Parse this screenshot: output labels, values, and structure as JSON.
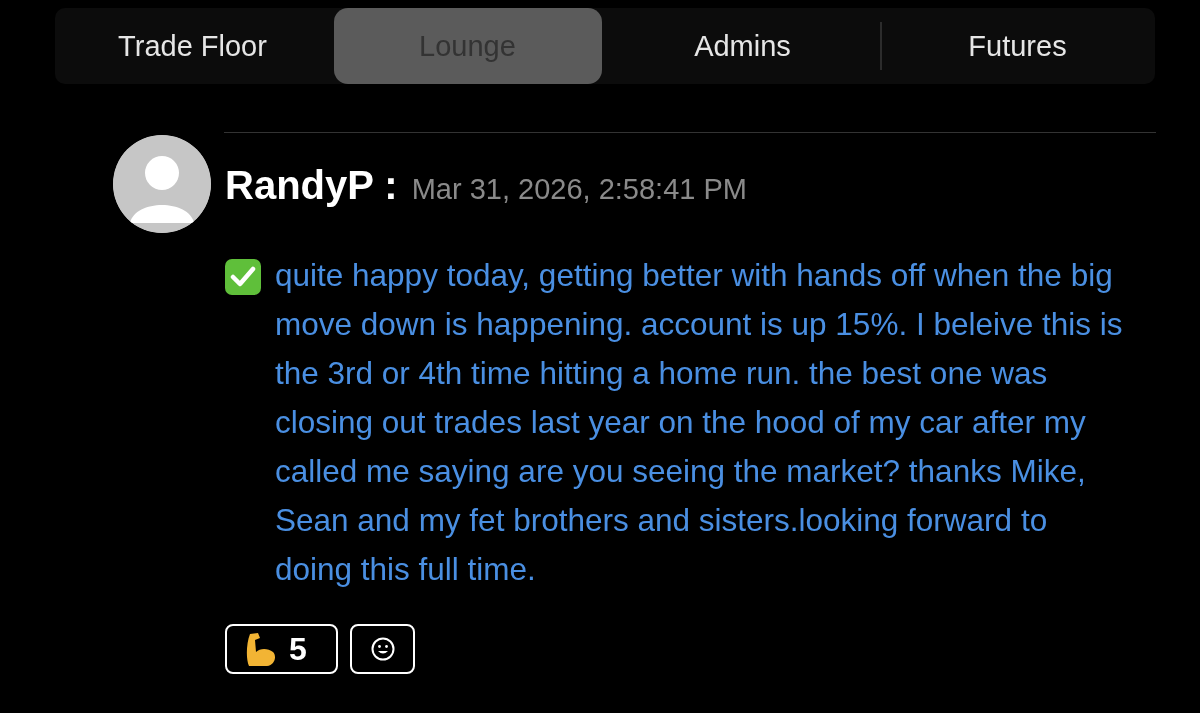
{
  "tabs": [
    {
      "label": "Trade Floor",
      "selected": false
    },
    {
      "label": "Lounge",
      "selected": true
    },
    {
      "label": "Admins",
      "selected": false
    },
    {
      "label": "Futures",
      "selected": false
    }
  ],
  "message": {
    "author": "RandyP :",
    "timestamp": "Mar 31, 2026, 2:58:41 PM",
    "text": "quite happy today, getting better with hands off when the big move down is happening. account is up 15%. I beleive this is the 3rd or 4th time hitting a home run. the best one was closing out trades last year on the hood of my car after my called me saying are you seeing the market? thanks Mike, Sean and my fet brothers and sisters.looking forward to doing this full time.",
    "reactions": [
      {
        "kind": "flexed-arm",
        "count": "5"
      },
      {
        "kind": "add"
      }
    ]
  }
}
